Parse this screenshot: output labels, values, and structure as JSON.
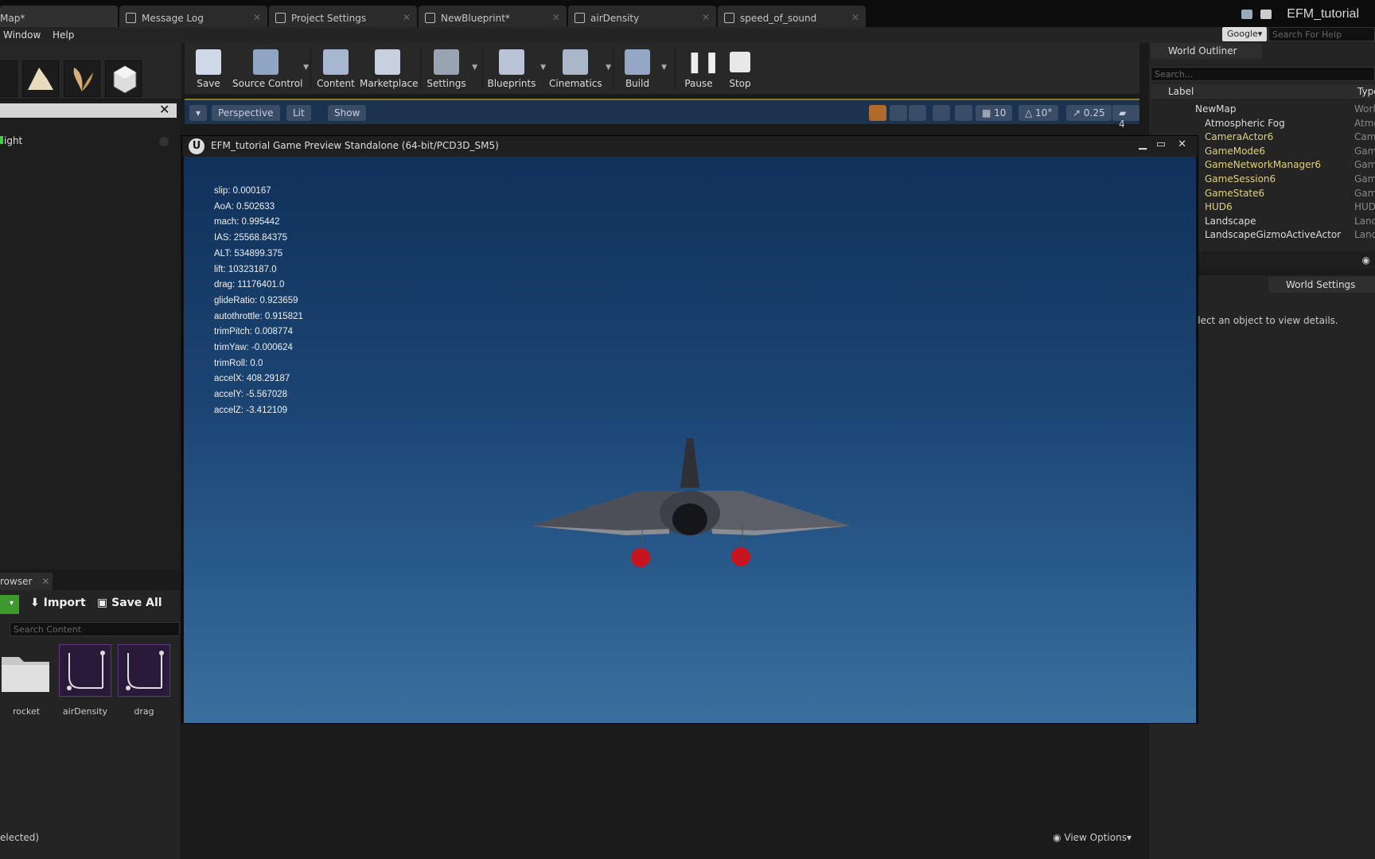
{
  "tabs": [
    {
      "label": "Map*"
    },
    {
      "label": "Message Log"
    },
    {
      "label": "Project Settings"
    },
    {
      "label": "NewBlueprint*"
    },
    {
      "label": "airDensity"
    },
    {
      "label": "speed_of_sound"
    }
  ],
  "app_title": "EFM_tutorial",
  "menu": {
    "window": "Window",
    "help": "Help"
  },
  "help_search": {
    "engine": "Google",
    "placeholder": "Search For Help"
  },
  "toolbar": [
    {
      "label": "Save",
      "icon": "save-icon"
    },
    {
      "label": "Source Control",
      "icon": "source-control-icon"
    },
    {
      "label": "Content",
      "icon": "content-icon"
    },
    {
      "label": "Marketplace",
      "icon": "marketplace-icon"
    },
    {
      "label": "Settings",
      "icon": "settings-icon"
    },
    {
      "label": "Blueprints",
      "icon": "blueprints-icon"
    },
    {
      "label": "Cinematics",
      "icon": "cinematics-icon"
    },
    {
      "label": "Build",
      "icon": "build-icon"
    },
    {
      "label": "Pause",
      "icon": "pause-icon"
    },
    {
      "label": "Stop",
      "icon": "stop-icon"
    }
  ],
  "viewport_bar": {
    "perspective": "Perspective",
    "lit": "Lit",
    "show": "Show",
    "grid_snap": "10",
    "rot_snap": "10°",
    "scale_snap": "0.25",
    "cam_speed": "4"
  },
  "left_panel": {
    "item": "ight"
  },
  "content_browser": {
    "tab": "rowser",
    "import": "Import",
    "save_all": "Save All",
    "search_placeholder": "Search Content",
    "assets": [
      {
        "name": "rocket",
        "kind": "folder"
      },
      {
        "name": "airDensity",
        "kind": "blueprint"
      },
      {
        "name": "drag",
        "kind": "blueprint"
      }
    ],
    "selection": "elected)"
  },
  "view_options": "View Options",
  "game_window": {
    "title": "EFM_tutorial Game Preview Standalone (64-bit/PCD3D_SM5)",
    "hud": [
      "slip: 0.000167",
      "AoA: 0.502633",
      "mach: 0.995442",
      "IAS: 25568.84375",
      "ALT: 534899.375",
      "lift: 10323187.0",
      "drag: 11176401.0",
      "glideRatio: 0.923659",
      "autothrottle: 0.915821",
      "trimPitch: 0.008774",
      "trimYaw: -0.000624",
      "trimRoll: 0.0",
      "accelX: 408.29187",
      "accelY: -5.567028",
      "accelZ: -3.412109"
    ]
  },
  "outliner": {
    "tab": "World Outliner",
    "search_placeholder": "Search...",
    "col_label": "Label",
    "col_type": "Type",
    "rows": [
      {
        "label": "NewMap",
        "type": "World",
        "indent": 0
      },
      {
        "label": "Atmospheric Fog",
        "type": "Atmo",
        "indent": 1
      },
      {
        "label": "CameraActor6",
        "type": "Came",
        "indent": 1
      },
      {
        "label": "GameMode6",
        "type": "Game",
        "indent": 1
      },
      {
        "label": "GameNetworkManager6",
        "type": "Game",
        "indent": 1
      },
      {
        "label": "GameSession6",
        "type": "Game",
        "indent": 1
      },
      {
        "label": "GameState6",
        "type": "Game",
        "indent": 1
      },
      {
        "label": "HUD6",
        "type": "HUD",
        "indent": 1
      },
      {
        "label": "Landscape",
        "type": "Land",
        "indent": 1
      },
      {
        "label": "LandscapeGizmoActiveActor",
        "type": "Land",
        "indent": 1
      }
    ]
  },
  "details": {
    "tab": "World Settings",
    "message": "Select an object to view details."
  }
}
